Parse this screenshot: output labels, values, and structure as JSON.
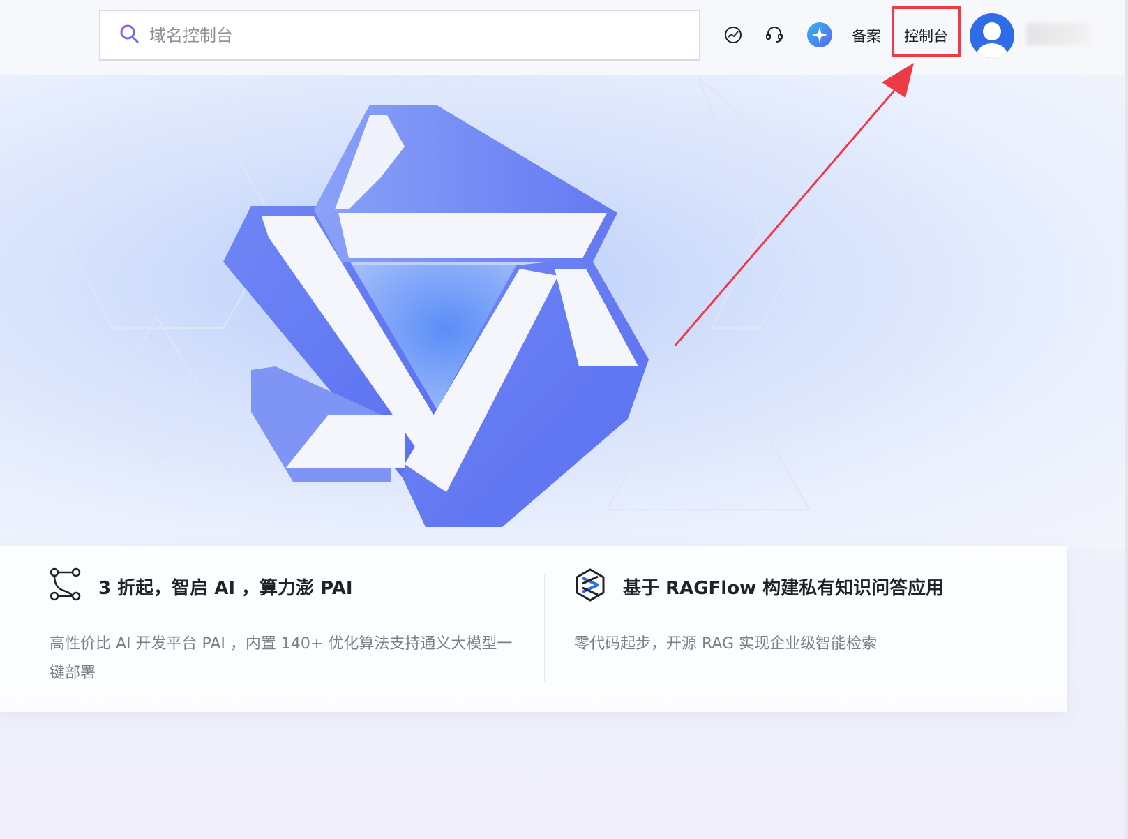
{
  "search": {
    "placeholder": "域名控制台"
  },
  "header": {
    "beian_label": "备案",
    "console_label": "控制台"
  },
  "icons": {
    "search": "search-icon",
    "dashboard": "gauge-icon",
    "support": "headset-icon",
    "ai_assistant": "sparkle-icon",
    "user": "avatar-icon"
  },
  "cards": [
    {
      "title": "3 折起，智启 AI ，算力澎 PAI",
      "desc": "高性价比 AI 开发平台 PAI ，内置 140+ 优化算法支持通义大模型一键部署",
      "icon": "flow-nodes-icon"
    },
    {
      "title": "基于 RAGFlow 构建私有知识问答应用",
      "desc": "零代码起步，开源 RAG 实现企业级智能检索",
      "icon": "ragflow-logo-icon"
    }
  ],
  "colors": {
    "highlight": "#ee3a47",
    "brand": "#5b72f2",
    "avatar": "#2f6de8"
  }
}
